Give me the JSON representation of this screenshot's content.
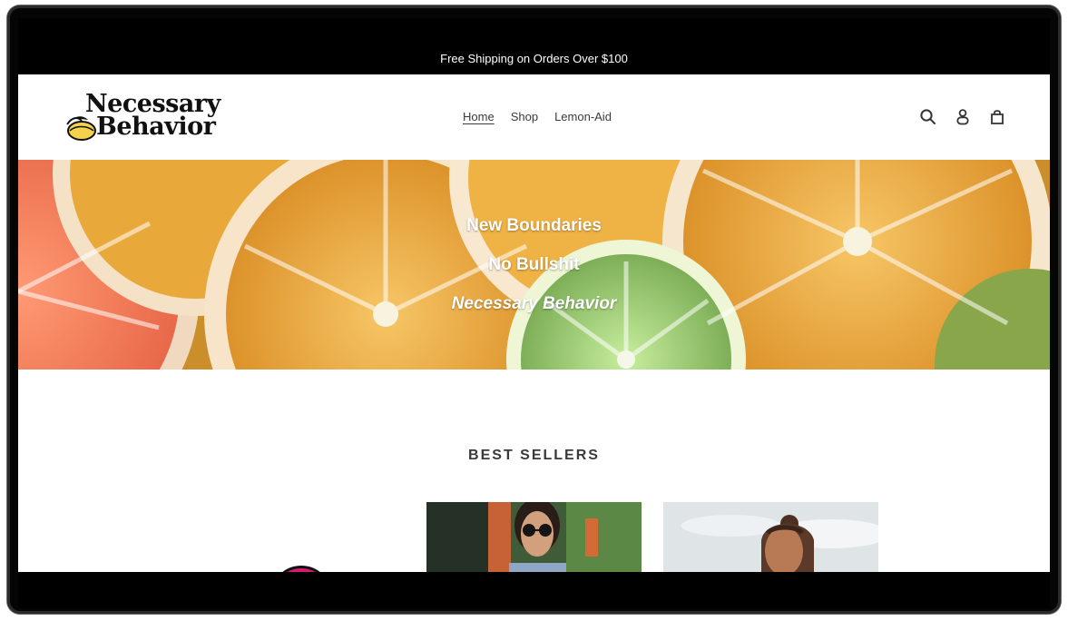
{
  "announcement": {
    "text": "Free Shipping on Orders Over $100"
  },
  "header": {
    "logo_line1": "Necessary",
    "logo_line2": "Behavior",
    "nav": [
      {
        "label": "Home",
        "active": true
      },
      {
        "label": "Shop",
        "active": false
      },
      {
        "label": "Lemon-Aid",
        "active": false
      }
    ],
    "icons": [
      "search-icon",
      "account-icon",
      "cart-icon"
    ]
  },
  "hero": {
    "lines": [
      "New Boundaries",
      "No Bullshit",
      "Necessary Behavior"
    ]
  },
  "section": {
    "title": "BEST SELLERS"
  },
  "colors": {
    "black": "#000000",
    "orange": "#e8a326",
    "lime": "#86c760",
    "grapefruit": "#ef6e4f",
    "text_gray": "#3a3a3a",
    "badge_pink": "#d81b6e"
  }
}
